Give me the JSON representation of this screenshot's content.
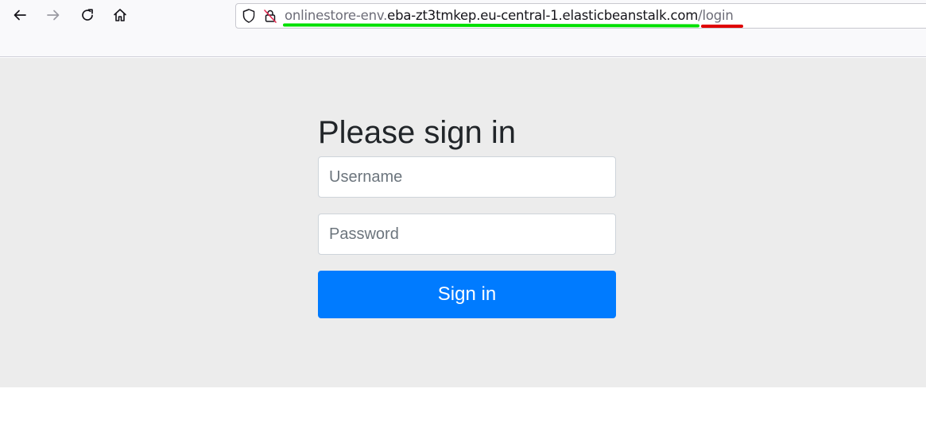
{
  "browser": {
    "back_icon": "arrow-left-icon",
    "forward_icon": "arrow-right-icon",
    "reload_icon": "reload-icon",
    "home_icon": "home-icon",
    "url": {
      "prefix": "onlinestore-env.",
      "host": "eba-zt3tmkep.eu-central-1.elasticbeanstalk.com",
      "path": "/login"
    },
    "highlight_colors": {
      "green": "#00e000",
      "red": "#e00000"
    }
  },
  "login": {
    "heading": "Please sign in",
    "username_placeholder": "Username",
    "username_value": "",
    "password_placeholder": "Password",
    "password_value": "",
    "submit_label": "Sign in",
    "accent_color": "#007bff"
  }
}
